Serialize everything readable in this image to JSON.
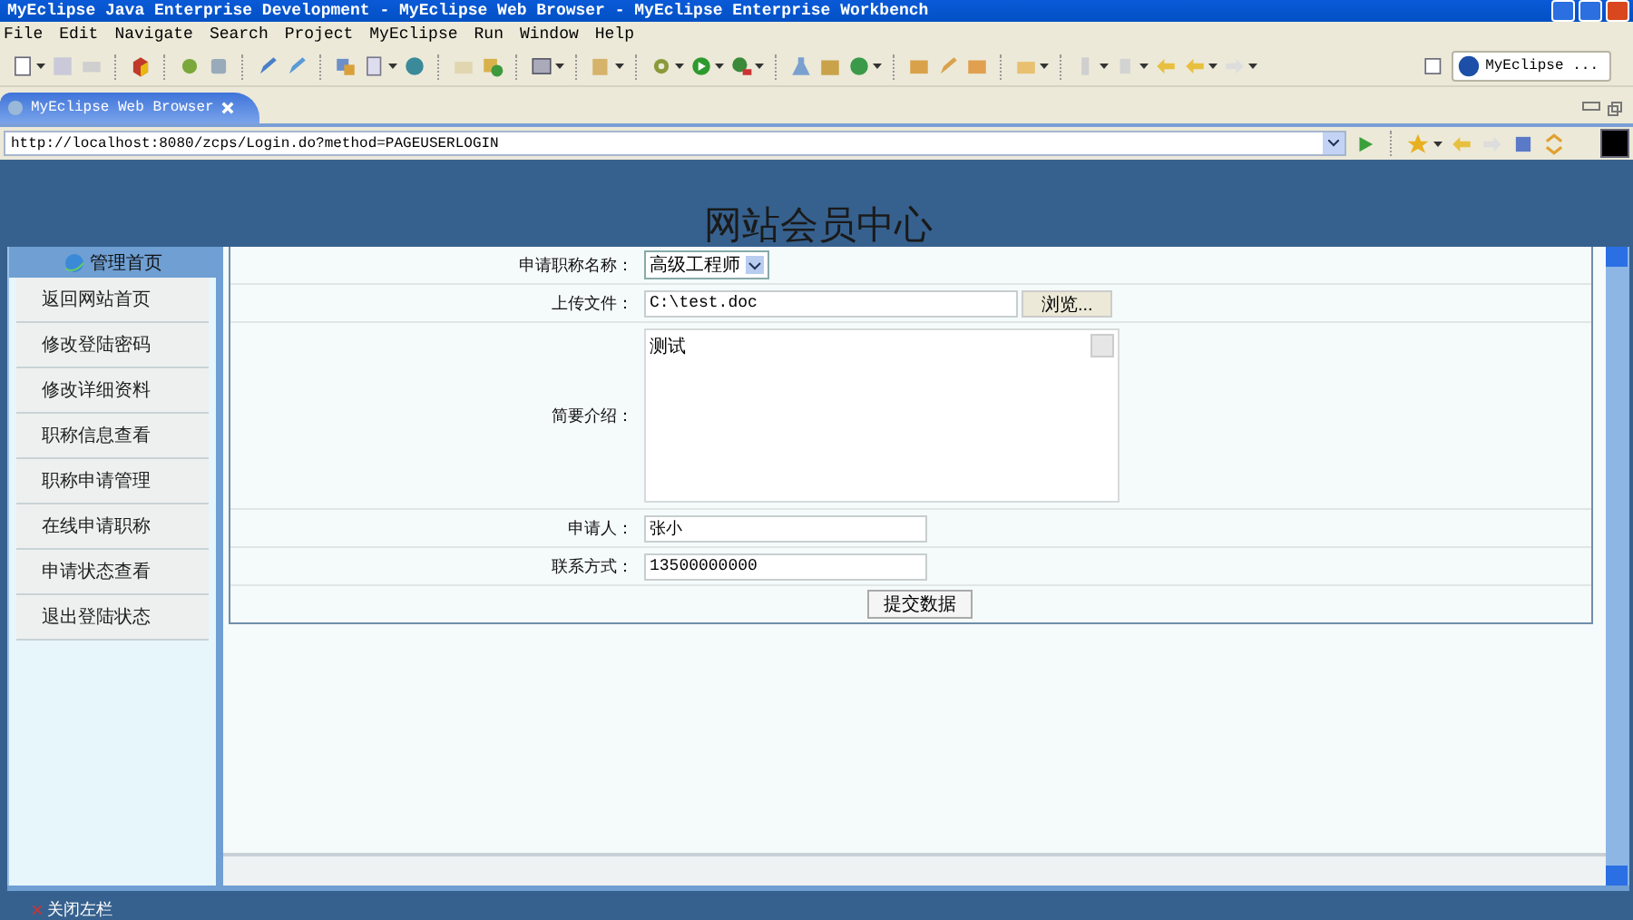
{
  "window": {
    "title": "MyEclipse Java Enterprise Development - MyEclipse Web Browser - MyEclipse Enterprise Workbench"
  },
  "menu": [
    "File",
    "Edit",
    "Navigate",
    "Search",
    "Project",
    "MyEclipse",
    "Run",
    "Window",
    "Help"
  ],
  "perspective": {
    "label": "MyEclipse ..."
  },
  "editor_tab": {
    "label": "MyEclipse Web Browser",
    "selected": true
  },
  "address": {
    "value": "http://localhost:8080/zcps/Login.do?method=PAGEUSERLOGIN"
  },
  "page": {
    "title": "网站会员中心",
    "sidebar": {
      "header": "管理首页",
      "items": [
        {
          "label": "返回网站首页"
        },
        {
          "label": "修改登陆密码"
        },
        {
          "label": "修改详细资料"
        },
        {
          "label": "职称信息查看"
        },
        {
          "label": "职称申请管理"
        },
        {
          "label": "在线申请职称"
        },
        {
          "label": "申请状态查看"
        },
        {
          "label": "退出登陆状态"
        }
      ]
    },
    "form": {
      "rows": [
        {
          "kind": "select",
          "label": "申请职称名称：",
          "value": "高级工程师"
        },
        {
          "kind": "file",
          "label": "上传文件：",
          "value": "C:\\test.doc",
          "button": "浏览..."
        },
        {
          "kind": "textarea",
          "label": "简要介绍：",
          "value": "测试"
        },
        {
          "kind": "text",
          "label": "申请人：",
          "value": "张小"
        },
        {
          "kind": "text",
          "label": "联系方式：",
          "value": "13500000000"
        }
      ],
      "submit": "提交数据"
    },
    "footer": {
      "label": "关闭左栏"
    }
  }
}
